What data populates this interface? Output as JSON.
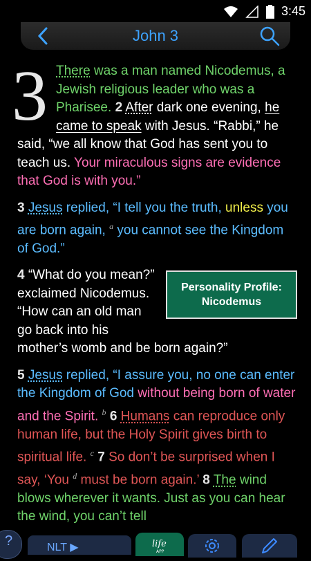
{
  "status": {
    "time": "3:45"
  },
  "header": {
    "title": "John 3"
  },
  "chapter": {
    "number": "3"
  },
  "v1": {
    "a": "There",
    "b": " was a man named Nicodemus, a Jewish religious leader who was a Pharisee.",
    "num2": "2",
    "c": "After",
    "d": " dark one evening, ",
    "e": "he came to speak",
    "f": " with Jesus. “Rabbi,” he said, “we all know that God has sent you to teach us. ",
    "g": "Your miraculous signs are evidence that God is with you.”"
  },
  "v3": {
    "num": "3",
    "a": "Jesus",
    "b": " replied, “I tell you the truth, ",
    "c": "unless",
    "d": " you are born again,",
    "fn": "a",
    "e": " you cannot see the Kingdom of God.”"
  },
  "v4": {
    "num": "4",
    "text": "“What do you mean?” exclaimed Nicodemus. “How can an old man go back into his mother’s womb and be born again?”"
  },
  "profile": {
    "label": "Personality Profile: Nicodemus"
  },
  "v5": {
    "num": "5",
    "a": "Jesus",
    "b": " replied, “I assure you, no one can enter the Kingdom of God ",
    "c": "without being born of water and the Spirit.",
    "fn_b": "b",
    "num6": "6",
    "d": "Humans",
    "e": " can reproduce only human life, but the Holy Spirit gives birth to spiritual life.",
    "fn_c": "c",
    "num7": "7",
    "f": " So don’t be surprised when I say, ‘You",
    "fn_d": "d",
    "g": " must be born again.’",
    "num8": "8",
    "h": "The",
    "i": " wind blows wherever it wants. Just as you can hear the wind, you can’t tell"
  },
  "bottom": {
    "help": "?",
    "version": "NLT ▶",
    "life": "life APP"
  },
  "colors": {
    "accent": "#3da3ff",
    "green_box": "#0d6b4c",
    "nav_bg": "#1d2a44"
  }
}
